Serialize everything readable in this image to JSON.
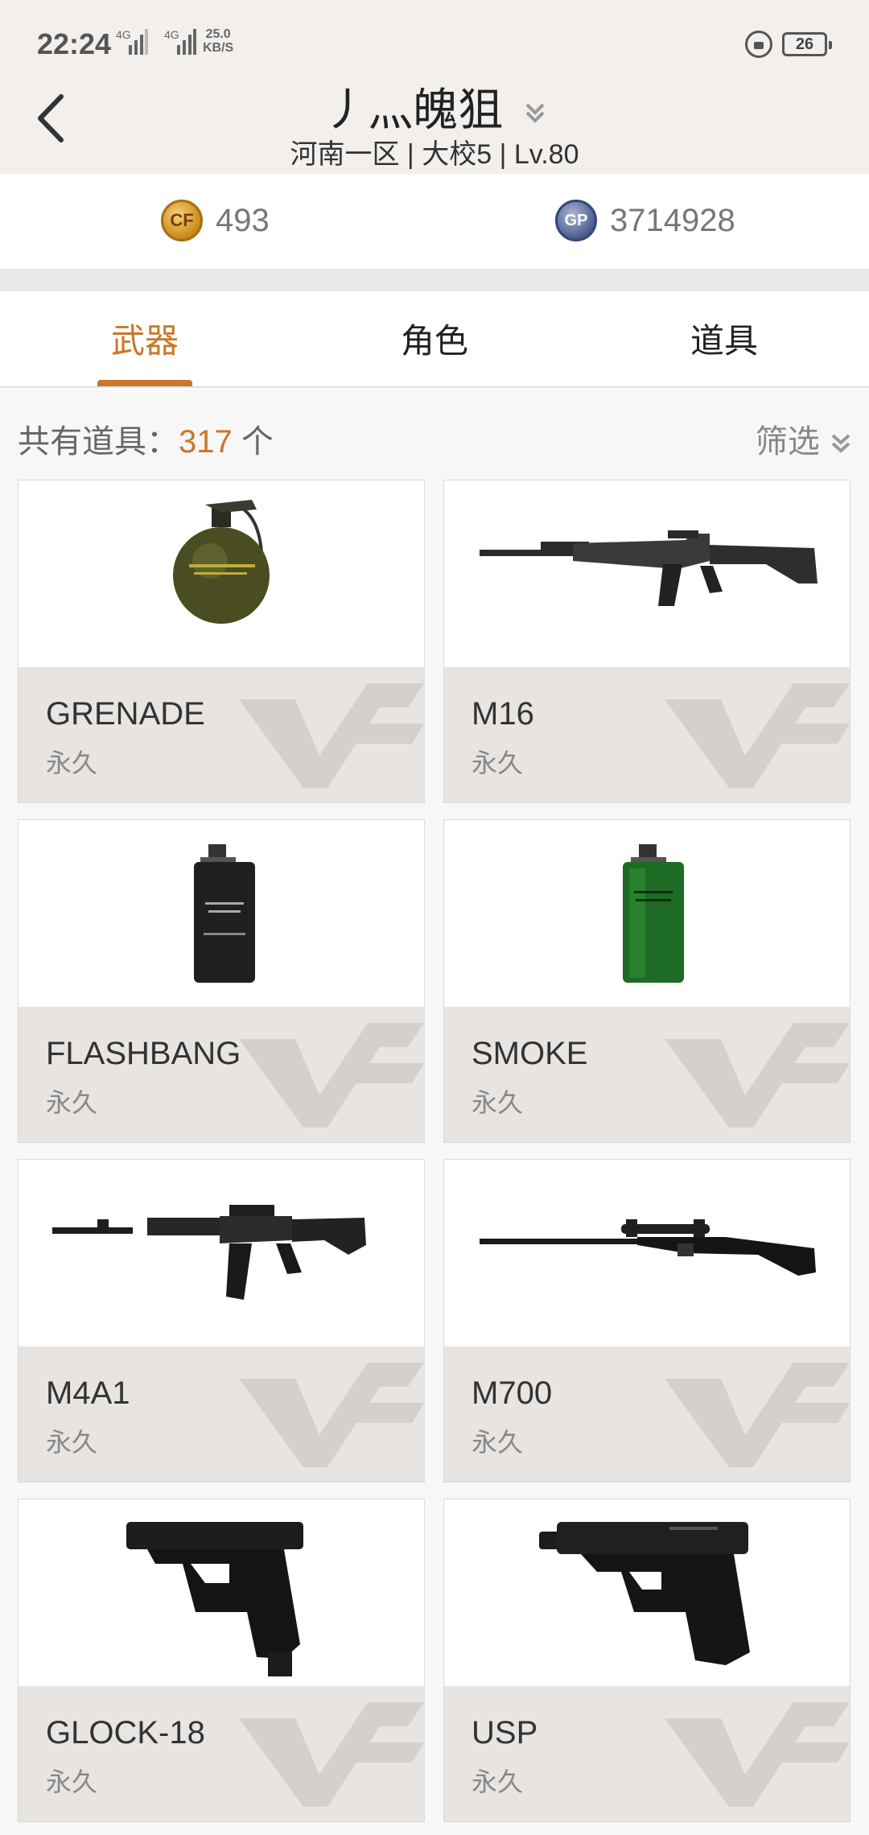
{
  "status_bar": {
    "time": "22:24",
    "sim1": "4G",
    "sim2": "4G",
    "net_speed_value": "25.0",
    "net_speed_unit": "KB/S",
    "battery": "26"
  },
  "header": {
    "title": "丿灬魄狙",
    "subtitle": "河南一区 | 大校5 | Lv.80"
  },
  "currency": {
    "cf_points": "493",
    "gp": "3714928",
    "cf_coin_label": "CF",
    "gp_coin_label": "GP"
  },
  "tabs": [
    {
      "label": "武器",
      "active": true
    },
    {
      "label": "角色",
      "active": false
    },
    {
      "label": "道具",
      "active": false
    }
  ],
  "summary": {
    "count_prefix": "共有道具：",
    "count": "317",
    "count_suffix": " 个",
    "filter_label": "筛选"
  },
  "items": [
    {
      "name": "GRENADE",
      "duration": "永久",
      "icon": "grenade-icon"
    },
    {
      "name": "M16",
      "duration": "永久",
      "icon": "rifle-icon"
    },
    {
      "name": "FLASHBANG",
      "duration": "永久",
      "icon": "flashbang-icon"
    },
    {
      "name": "SMOKE",
      "duration": "永久",
      "icon": "smoke-grenade-icon"
    },
    {
      "name": "M4A1",
      "duration": "永久",
      "icon": "carbine-icon"
    },
    {
      "name": "M700",
      "duration": "永久",
      "icon": "sniper-rifle-icon"
    },
    {
      "name": "GLOCK-18",
      "duration": "永久",
      "icon": "pistol-icon"
    },
    {
      "name": "USP",
      "duration": "永久",
      "icon": "pistol-icon"
    }
  ],
  "colors": {
    "accent": "#c8782a",
    "header_bg": "#f2efec",
    "card_info_bg": "#e7e4e1"
  }
}
